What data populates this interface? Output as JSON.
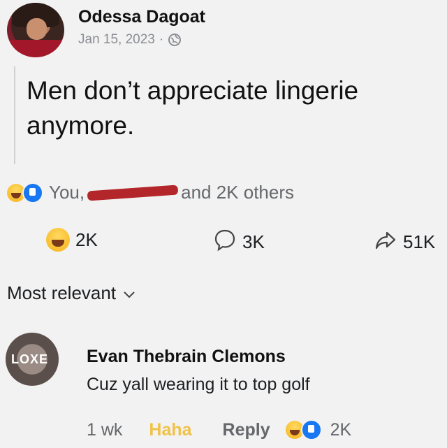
{
  "post": {
    "author": "Odessa Dagoat",
    "date": "Jan 15, 2023",
    "separator": "·",
    "audience_icon": "globe-icon",
    "text": "Men don’t appreciate lingerie anymore."
  },
  "reactions_summary": {
    "prefix": "You,",
    "suffix": "and 2K others",
    "icons": [
      "haha-icon",
      "like-icon"
    ]
  },
  "counts": {
    "reactions": "2K",
    "comments": "3K",
    "shares": "51K"
  },
  "sort": {
    "label": "Most relevant"
  },
  "comment": {
    "author": "Evan Thebrain Clemons",
    "text": "Cuz yall wearing it to top golf",
    "time": "1 wk",
    "haha_label": "Haha",
    "reply_label": "Reply",
    "reaction_count": "2K",
    "avatar_text": "LOXE"
  },
  "colors": {
    "background": "#f2f2f2",
    "like_blue": "#1877f2",
    "haha_yellow": "#f6b21a",
    "muted_text": "#65676b"
  }
}
